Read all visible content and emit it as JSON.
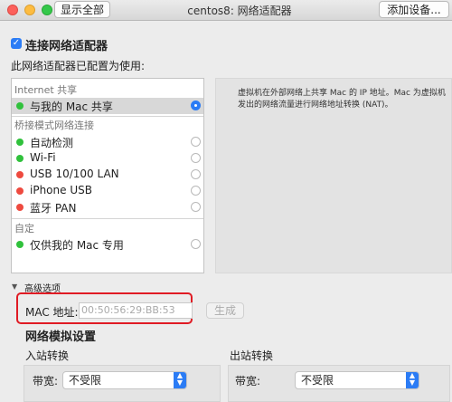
{
  "window": {
    "title": "centos8: 网络适配器",
    "show_all_label": "显示全部",
    "add_device_label": "添加设备..."
  },
  "connect": {
    "checkbox_label": "连接网络适配器",
    "checked": true,
    "subtitle": "此网络适配器已配置为使用:"
  },
  "groups": {
    "internet_sharing": "Internet 共享",
    "bridged": "桥接模式网络连接",
    "custom": "自定"
  },
  "items": {
    "share_mac": {
      "label": "与我的 Mac 共享",
      "status": "green",
      "selected": true
    },
    "auto_detect": {
      "label": "自动检测",
      "status": "green"
    },
    "wifi": {
      "label": "Wi-Fi",
      "status": "green"
    },
    "usb_lan": {
      "label": "USB 10/100 LAN",
      "status": "red"
    },
    "iphone_usb": {
      "label": "iPhone USB",
      "status": "red"
    },
    "bluetooth_pan": {
      "label": "蓝牙 PAN",
      "status": "red"
    },
    "mac_only": {
      "label": "仅供我的 Mac 专用",
      "status": "green"
    }
  },
  "description": "虚拟机在外部网络上共享 Mac 的 IP 地址。Mac 为虚拟机发出的网络流量进行网络地址转换 (NAT)。",
  "advanced": {
    "label": "高级选项",
    "mac_label": "MAC 地址:",
    "mac_value": "00:50:56:29:BB:53",
    "generate_label": "生成"
  },
  "network_sim": {
    "title": "网络模拟设置",
    "inbound_title": "入站转换",
    "outbound_title": "出站转换",
    "bandwidth_label": "带宽:",
    "inbound_bandwidth": "不受限",
    "outbound_bandwidth": "不受限"
  },
  "colors": {
    "accent": "#2b7cf5",
    "status_green": "#30c13c",
    "status_red": "#ee4a3f",
    "highlight": "#e01b24"
  }
}
